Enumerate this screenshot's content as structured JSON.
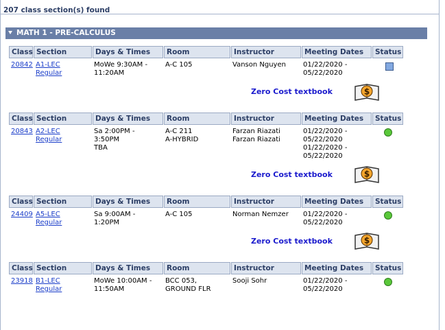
{
  "results": {
    "count_text": "207 class section(s) found"
  },
  "course": {
    "title": "MATH 1 - PRE-CALCULUS"
  },
  "headers": [
    "Class",
    "Section",
    "Days & Times",
    "Room",
    "Instructor",
    "Meeting Dates",
    "Status"
  ],
  "zero_cost": "Zero Cost textbook",
  "sections": [
    {
      "class": "20842",
      "section": "A1-LEC",
      "type": "Regular",
      "times": [
        "MoWe 9:30AM -",
        "11:20AM"
      ],
      "room": [
        "A-C 105"
      ],
      "instructor": [
        "Vanson Nguyen"
      ],
      "dates": [
        "01/22/2020 -",
        "05/22/2020"
      ],
      "status": "square"
    },
    {
      "class": "20843",
      "section": "A2-LEC",
      "type": "Regular",
      "times": [
        "Sa 2:00PM -",
        "3:50PM",
        "TBA"
      ],
      "room": [
        "A-C 211",
        "A-HYBRID"
      ],
      "instructor": [
        "Farzan Riazati",
        "Farzan Riazati"
      ],
      "dates": [
        "01/22/2020 -",
        "05/22/2020",
        "01/22/2020 -",
        "05/22/2020"
      ],
      "status": "circle"
    },
    {
      "class": "24409",
      "section": "A5-LEC",
      "type": "Regular",
      "times": [
        "Sa 9:00AM -",
        "1:20PM"
      ],
      "room": [
        "A-C 105"
      ],
      "instructor": [
        "Norman Nemzer"
      ],
      "dates": [
        "01/22/2020 -",
        "05/22/2020"
      ],
      "status": "circle"
    },
    {
      "class": "23918",
      "section": "B1-LEC",
      "type": "Regular",
      "times": [
        "MoWe 10:00AM -",
        "11:50AM"
      ],
      "room": [
        "BCC 053,",
        "GROUND FLR"
      ],
      "instructor": [
        "Sooji Sohr"
      ],
      "dates": [
        "01/22/2020 -",
        "05/22/2020"
      ],
      "status": "circle"
    }
  ],
  "colors": {
    "header_bg": "#dde4ef",
    "bar_bg": "#6a7fa7",
    "link": "#1a3dc9",
    "open_status": "#5ac83a",
    "closed_status": "#82a8e0"
  }
}
